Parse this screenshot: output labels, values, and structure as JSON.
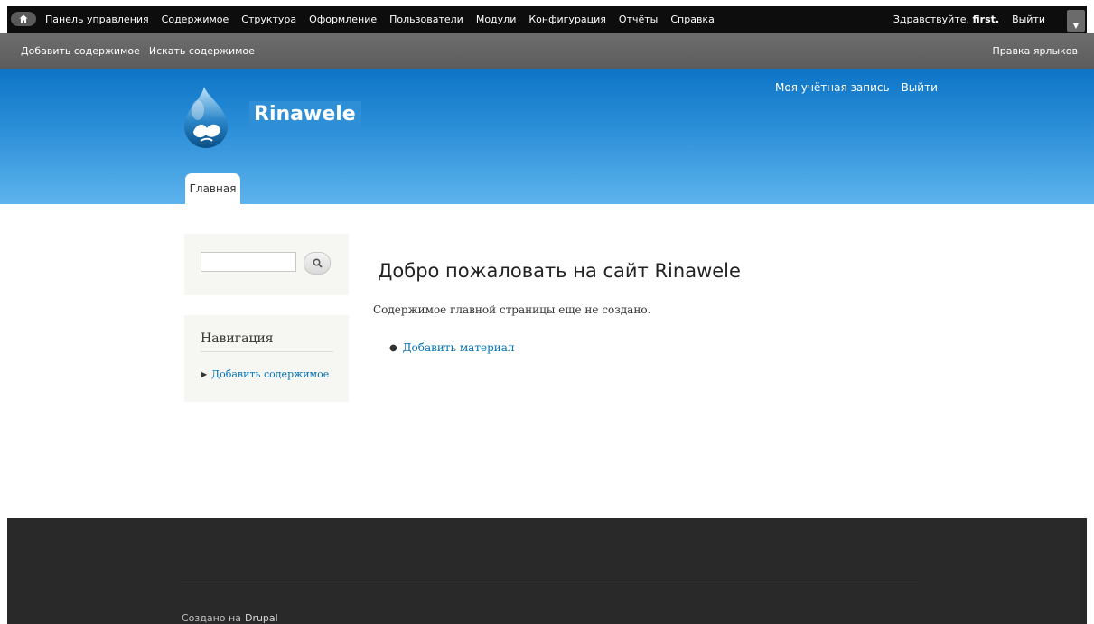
{
  "toolbar": {
    "menu": [
      "Панель управления",
      "Содержимое",
      "Структура",
      "Оформление",
      "Пользователи",
      "Модули",
      "Конфигурация",
      "Отчёты",
      "Справка"
    ],
    "greeting_prefix": "Здравствуйте,",
    "username": "first.",
    "logout": "Выйти"
  },
  "shortcuts": {
    "items": [
      "Добавить содержимое",
      "Искать содержимое"
    ],
    "edit": "Правка ярлыков"
  },
  "header": {
    "site_name": "Rinawele",
    "secondary_menu": [
      "Моя учётная запись",
      "Выйти"
    ],
    "main_tab": "Главная"
  },
  "sidebar": {
    "nav_title": "Навигация",
    "nav_item": "Добавить содержимое"
  },
  "content": {
    "title": "Добро пожаловать на сайт Rinawele",
    "intro": "Содержимое главной страницы еще не создано.",
    "link": "Добавить материал"
  },
  "footer": {
    "text": "Создано на",
    "link": "Drupal"
  },
  "colors": {
    "toolbar": "#0d0d0d",
    "shortcuts": "#666666",
    "header_top": "#0d74c6",
    "header_bottom": "#5db3ec",
    "link": "#0071b3",
    "footer": "#292929"
  }
}
